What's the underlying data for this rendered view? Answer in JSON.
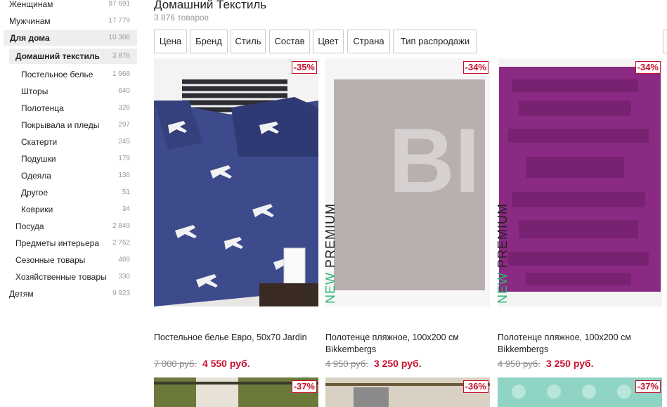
{
  "sidebar": {
    "items": [
      {
        "label": "Женщинам",
        "count": "97 691"
      },
      {
        "label": "Мужчинам",
        "count": "17 779"
      },
      {
        "label": "Для дома",
        "count": "10 306"
      },
      {
        "label": "Домашний текстиль",
        "count": "3 876"
      },
      {
        "label": "Постельное белье",
        "count": "1 968"
      },
      {
        "label": "Шторы",
        "count": "640"
      },
      {
        "label": "Полотенца",
        "count": "326"
      },
      {
        "label": "Покрывала и пледы",
        "count": "297"
      },
      {
        "label": "Скатерти",
        "count": "245"
      },
      {
        "label": "Подушки",
        "count": "179"
      },
      {
        "label": "Одеяла",
        "count": "136"
      },
      {
        "label": "Другое",
        "count": "51"
      },
      {
        "label": "Коврики",
        "count": "34"
      },
      {
        "label": "Посуда",
        "count": "2 849"
      },
      {
        "label": "Предметы интерьера",
        "count": "2 762"
      },
      {
        "label": "Сезонные товары",
        "count": "489"
      },
      {
        "label": "Хозяйственные товары",
        "count": "330"
      },
      {
        "label": "Детям",
        "count": "9 923"
      }
    ]
  },
  "header": {
    "title": "Домашний Текстиль",
    "count": "3 876 товаров"
  },
  "filters": [
    "Цена",
    "Бренд",
    "Стиль",
    "Состав",
    "Цвет",
    "Страна",
    "Тип распродажи"
  ],
  "products": [
    {
      "discount": "-35%",
      "title": "Постельное белье Евро, 50x70 Jardin",
      "old_price": "7 000 руб.",
      "new_price": "4 550 руб.",
      "new_tag": ""
    },
    {
      "discount": "-34%",
      "title": "Полотенце пляжное, 100x200 см Bikkembergs",
      "old_price": "4 950 руб.",
      "new_price": "3 250 руб.",
      "new_tag": "PREMIUM",
      "new_word": "NEW",
      "image_letters": "BI"
    },
    {
      "discount": "-34%",
      "title": "Полотенце пляжное, 100x200 см Bikkembergs",
      "old_price": "4 950 руб.",
      "new_price": "3 250 руб.",
      "new_tag": "PREMIUM",
      "new_word": "NEW"
    }
  ],
  "next_row": [
    {
      "discount": "-37%"
    },
    {
      "discount": "-36%"
    },
    {
      "discount": "-37%"
    }
  ],
  "colors": {
    "accent": "#c8102e",
    "new_green": "#2bb673",
    "bedding": "#3d4a8c",
    "towel_grey": "#b8afaf",
    "towel_purple": "#8a2a82"
  }
}
